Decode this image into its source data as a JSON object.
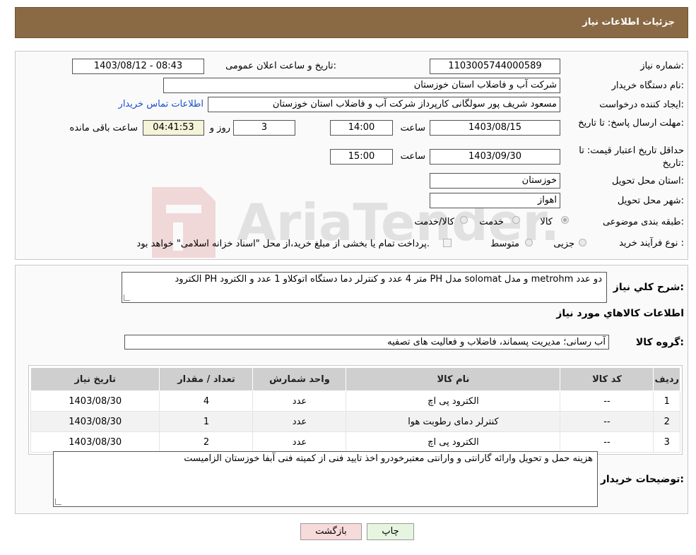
{
  "header": {
    "title": "جزئیات اطلاعات نیاز"
  },
  "info": {
    "need_number_label": "شماره نیاز:",
    "need_number": "1103005744000589",
    "announce_label": "تاریخ و ساعت اعلان عمومی:",
    "announce_value": "1403/08/12 - 08:43",
    "buyer_org_label": "نام دستگاه خریدار:",
    "buyer_org": "شرکت آب و فاضلاب استان خوزستان",
    "creator_label": "ایجاد کننده درخواست:",
    "creator": "مسعود شریف پور سولگانی کارپرداز شرکت آب و فاضلاب استان خوزستان",
    "contact_link": "اطلاعات تماس خریدار",
    "deadline_label": "مهلت ارسال پاسخ: تا تاریخ:",
    "deadline_date": "1403/08/15",
    "time_label": "ساعت",
    "deadline_time": "14:00",
    "days_value": "3",
    "days_label": "روز و",
    "remaining_time": "04:41:53",
    "remaining_label": "ساعت باقی مانده",
    "validity_label": "حداقل تاریخ اعتبار قیمت: تا تاریخ:",
    "validity_date": "1403/09/30",
    "validity_time": "15:00",
    "province_label": "استان محل تحویل:",
    "province": "خوزستان",
    "city_label": "شهر محل تحویل:",
    "city": "اهواز",
    "category_label": "طبقه بندی موضوعی:",
    "category_options": [
      "کالا",
      "خدمت",
      "کالا/خدمت"
    ],
    "purchase_type_label": "نوع فرآیند خرید :",
    "purchase_options": [
      "جزیی",
      "متوسط"
    ],
    "payment_note": "پرداخت تمام یا بخشی از مبلغ خرید،از محل \"اسناد خزانه اسلامی\" خواهد بود."
  },
  "description": {
    "label": "شرح کلي نیاز:",
    "text": "الکترود PH متر 4 عدد و کنترلر دما دستگاه اتوکلاو 1 عدد و الکترود PH مدل solomat و مدل metrohm دو عدد",
    "items_heading": "اطلاعات کالاهاي مورد نیاز",
    "group_label": "گروه کالا:",
    "group_value": "آب رسانی؛ مدیریت پسماند، فاضلاب و فعالیت های تصفیه"
  },
  "table": {
    "headers": [
      "ردیف",
      "کد کالا",
      "نام کالا",
      "واحد شمارش",
      "تعداد / مقدار",
      "تاریخ نیاز"
    ],
    "rows": [
      [
        "1",
        "--",
        "الکترود پی اچ",
        "عدد",
        "4",
        "1403/08/30"
      ],
      [
        "2",
        "--",
        "کنترلر دمای رطوبت هوا",
        "عدد",
        "1",
        "1403/08/30"
      ],
      [
        "3",
        "--",
        "الکترود پی اچ",
        "عدد",
        "2",
        "1403/08/30"
      ]
    ]
  },
  "buyer_notes": {
    "label": "توضیحات خریدار:",
    "text": "هزینه حمل و تحویل وارائه گارانتی و وارانتی معتبرخودرو اخذ تایید فنی از کمیته فنی آبفا خوزستان الزامیست"
  },
  "buttons": {
    "print": "چاپ",
    "back": "بازگشت"
  },
  "colors": {
    "header_bg": "#8a6a45",
    "print_bg": "#e6f5e0",
    "back_bg": "#f7dada",
    "link": "#1a4fd0"
  }
}
